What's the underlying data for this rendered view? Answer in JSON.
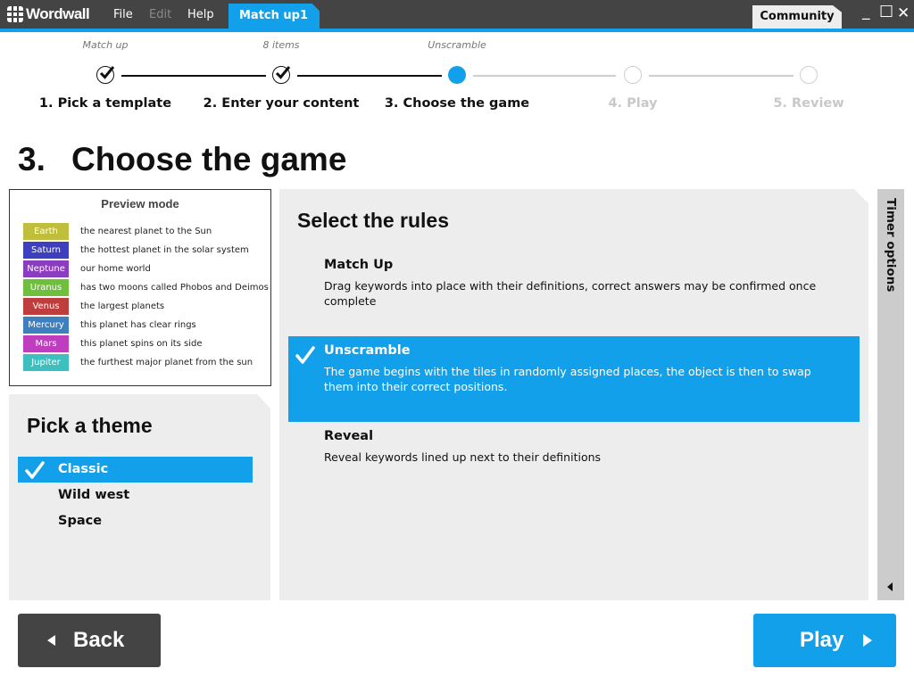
{
  "app": {
    "name": "Wordwall",
    "menu": [
      {
        "label": "File",
        "enabled": true
      },
      {
        "label": "Edit",
        "enabled": false
      },
      {
        "label": "Help",
        "enabled": true
      }
    ],
    "doc_tab": {
      "label": "Match up1",
      "close": "×"
    },
    "community_tab": "Community",
    "window_controls": {
      "minimize": "_",
      "maximize": "☐",
      "close": "✕"
    }
  },
  "stepper": {
    "steps": [
      {
        "label": "1. Pick a template",
        "sub": "Match up",
        "state": "done"
      },
      {
        "label": "2. Enter your content",
        "sub": "8 items",
        "state": "done"
      },
      {
        "label": "3. Choose the game",
        "sub": "Unscramble",
        "state": "current"
      },
      {
        "label": "4. Play",
        "sub": "",
        "state": "todo"
      },
      {
        "label": "5. Review",
        "sub": "",
        "state": "todo"
      }
    ]
  },
  "page": {
    "number": "3.",
    "title": "Choose the game"
  },
  "preview": {
    "title": "Preview mode",
    "items": [
      {
        "key": "Earth",
        "definition": "the nearest planet to the Sun",
        "color": "#bfbf3d"
      },
      {
        "key": "Saturn",
        "definition": "the hottest planet in the solar system",
        "color": "#3d3fbf"
      },
      {
        "key": "Neptune",
        "definition": "our home world",
        "color": "#8b3dbf"
      },
      {
        "key": "Uranus",
        "definition": "has two moons called Phobos and Deimos",
        "color": "#6fbf3d"
      },
      {
        "key": "Venus",
        "definition": "the largest planets",
        "color": "#bf3d3d"
      },
      {
        "key": "Mercury",
        "definition": "this planet has clear rings",
        "color": "#3d7fbf"
      },
      {
        "key": "Mars",
        "definition": "this planet spins on its side",
        "color": "#bf3dbf"
      },
      {
        "key": "Jupiter",
        "definition": "the furthest major planet from the sun",
        "color": "#3dbfbf"
      }
    ]
  },
  "themes": {
    "heading": "Pick a theme",
    "items": [
      {
        "label": "Classic",
        "selected": true
      },
      {
        "label": "Wild west",
        "selected": false
      },
      {
        "label": "Space",
        "selected": false
      }
    ]
  },
  "rules": {
    "heading": "Select the rules",
    "items": [
      {
        "title": "Match Up",
        "description": "Drag keywords into place with their definitions, correct answers may be confirmed once complete",
        "selected": false
      },
      {
        "title": "Unscramble",
        "description": "The game begins with the tiles in randomly assigned places, the object is then to swap them into their correct positions.",
        "selected": true
      },
      {
        "title": "Reveal",
        "description": "Reveal keywords lined up next to their definitions",
        "selected": false
      }
    ]
  },
  "timer_tab": {
    "label": "Timer options"
  },
  "buttons": {
    "back": "Back",
    "play": "Play"
  },
  "colors": {
    "accent": "#12a0ea",
    "dark": "#444444",
    "panel": "#ededed"
  }
}
